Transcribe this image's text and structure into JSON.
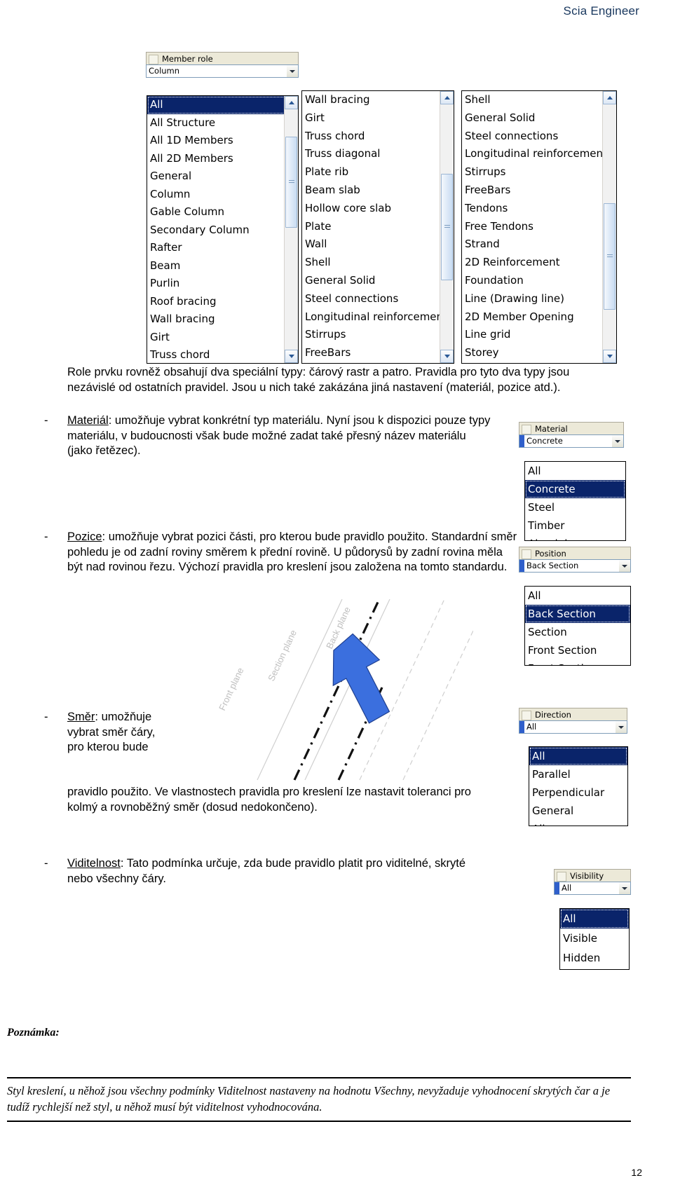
{
  "document": {
    "header": "Scia Engineer",
    "page_number": "12"
  },
  "member_role_panel": {
    "group_title": "Member role",
    "combo_value": "Column",
    "list_column_1": [
      "All",
      "All Structure",
      "All 1D Members",
      "All 2D Members",
      "General",
      "Column",
      "Gable Column",
      "Secondary Column",
      "Rafter",
      "Beam",
      "Purlin",
      "Roof bracing",
      "Wall bracing",
      "Girt",
      "Truss chord"
    ],
    "list_column_1_selected": "All",
    "list_column_2": [
      "Wall bracing",
      "Girt",
      "Truss chord",
      "Truss diagonal",
      "Plate rib",
      "Beam slab",
      "Hollow core slab",
      "Plate",
      "Wall",
      "Shell",
      "General Solid",
      "Steel connections",
      "Longitudinal reinforcemen",
      "Stirrups",
      "FreeBars"
    ],
    "list_column_3": [
      "Shell",
      "General Solid",
      "Steel connections",
      "Longitudinal reinforcemen",
      "Stirrups",
      "FreeBars",
      "Tendons",
      "Free Tendons",
      "Strand",
      "2D Reinforcement",
      "Foundation",
      "Line (Drawing line)",
      "2D Member Opening",
      "Line grid",
      "Storey"
    ]
  },
  "paragraphs": {
    "intro": "Role prvku rovněž obsahují dva speciální typy: čárový rastr a patro. Pravidla pro tyto dva typy jsou nezávislé od ostatních pravidel. Jsou u nich také zakázána jiná nastavení (materiál, pozice atd.).",
    "material_term": "Materiál",
    "material_rest": ": umožňuje vybrat konkrétní typ materiálu. Nyní jsou k dispozici pouze typy materiálu, v budoucnosti však bude možné zadat také přesný název materiálu (jako řetězec).",
    "position_term": "Pozice",
    "position_rest": ": umožňuje vybrat pozici části, pro kterou bude pravidlo použito. Standardní směr pohledu je od zadní roviny směrem k přední rovině. U půdorysů by zadní rovina měla být nad rovinou řezu. Výchozí pravidla pro kreslení jsou založena na tomto standardu.",
    "direction_term": "Směr",
    "direction_rest_narrow": ": umožňuje vybrat směr čáry, pro kterou bude",
    "direction_rest_wide": "pravidlo použito. Ve vlastnostech pravidla pro kreslení lze nastavit toleranci pro kolmý a rovnoběžný směr (dosud nedokončeno).",
    "visibility_term": "Viditelnost",
    "visibility_rest": ": Tato podmínka určuje, zda bude pravidlo platit pro viditelné, skryté nebo všechny čáry."
  },
  "note": {
    "label": "Poznámka:",
    "text": "Styl kreslení, u něhož jsou všechny podmínky Viditelnost nastaveny na hodnotu Všechny, nevyžaduje vyhodnocení skrytých čar a je tudíž rychlejší než styl, u něhož musí být viditelnost vyhodnocována."
  },
  "material_panel": {
    "group_title": "Material",
    "combo_value": "Concrete",
    "options": [
      "All",
      "Concrete",
      "Steel",
      "Timber",
      "Aluminium"
    ],
    "selected": "Concrete"
  },
  "position_panel": {
    "group_title": "Position",
    "combo_value": "Back Section",
    "options": [
      "All",
      "Back Section",
      "Section",
      "Front Section",
      "Front Section"
    ],
    "selected": "Back Section"
  },
  "direction_panel": {
    "group_title": "Direction",
    "combo_value": "All",
    "options": [
      "All",
      "Parallel",
      "Perpendicular",
      "General",
      "All"
    ],
    "selected": "All"
  },
  "visibility_panel": {
    "group_title": "Visibility",
    "combo_value": "All",
    "options": [
      "All",
      "Visible",
      "Hidden"
    ],
    "selected": "All"
  },
  "drawing": {
    "label_front_plane": "Front plane",
    "label_section_plane": "Section plane",
    "label_back_plane": "Back plane",
    "arrow_color": "#3B6FDE"
  }
}
